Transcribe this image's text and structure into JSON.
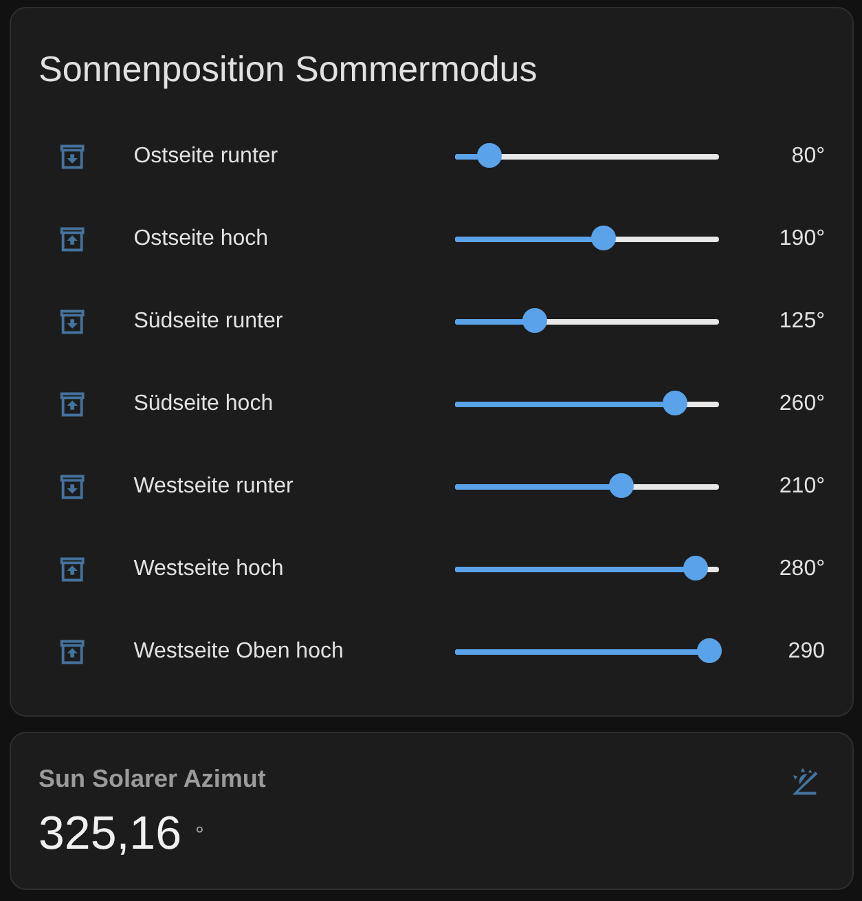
{
  "card": {
    "title": "Sonnenposition Sommermodus",
    "rows": [
      {
        "kind": "down",
        "label": "Ostseite runter",
        "level": 0.126,
        "reading": "80°"
      },
      {
        "kind": "up",
        "label": "Ostseite hoch",
        "level": 0.56,
        "reading": "190°"
      },
      {
        "kind": "down",
        "label": "Südseite runter",
        "level": 0.3,
        "reading": "125°"
      },
      {
        "kind": "up",
        "label": "Südseite hoch",
        "level": 0.83,
        "reading": "260°"
      },
      {
        "kind": "down",
        "label": "Westseite runter",
        "level": 0.63,
        "reading": "210°"
      },
      {
        "kind": "up",
        "label": "Westseite hoch",
        "level": 0.91,
        "reading": "280°"
      },
      {
        "kind": "up",
        "label": "Westseite Oben hoch",
        "level": 0.96,
        "reading": "290"
      }
    ]
  },
  "sensor": {
    "name": "Sun Solarer Azimut",
    "value": "325,16",
    "unit": "°"
  }
}
